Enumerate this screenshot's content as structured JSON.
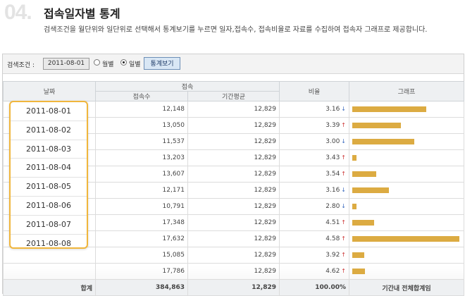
{
  "header": {
    "step": "04.",
    "title": "접속일자별 통계",
    "description": "검색조건을 월단위와 일단위로 선택해서 통계보기를 누르면 일자,접속수, 접속비율로 자료를 수집하여 접속자 그래프로 제공합니다."
  },
  "search": {
    "label": "검색조건 :",
    "date": "2011-08-01",
    "radio_month": "월별",
    "radio_day": "일별",
    "selected": "day",
    "button": "통계보기"
  },
  "table": {
    "headers": {
      "date": "날짜",
      "access": "접속",
      "access_count": "접속수",
      "period_avg": "기간평균",
      "ratio": "비율",
      "graph": "그래프"
    },
    "rows": [
      {
        "count": "12,148",
        "avg": "12,829",
        "ratio": "3.16",
        "trend": "down",
        "ratio_value": 3.16
      },
      {
        "count": "13,050",
        "avg": "12,829",
        "ratio": "3.39",
        "trend": "up",
        "ratio_value": 3.39
      },
      {
        "count": "11,537",
        "avg": "12,829",
        "ratio": "3.00",
        "trend": "down",
        "ratio_value": 3.0
      },
      {
        "count": "13,203",
        "avg": "12,829",
        "ratio": "3.43",
        "trend": "up",
        "ratio_value": 3.43
      },
      {
        "count": "13,607",
        "avg": "12,829",
        "ratio": "3.54",
        "trend": "up",
        "ratio_value": 3.54
      },
      {
        "count": "12,171",
        "avg": "12,829",
        "ratio": "3.16",
        "trend": "down",
        "ratio_value": 3.16
      },
      {
        "count": "10,791",
        "avg": "12,829",
        "ratio": "2.80",
        "trend": "down",
        "ratio_value": 2.8
      },
      {
        "count": "17,348",
        "avg": "12,829",
        "ratio": "4.51",
        "trend": "up",
        "ratio_value": 4.51
      },
      {
        "count": "17,632",
        "avg": "12,829",
        "ratio": "4.58",
        "trend": "up",
        "ratio_value": 4.58
      },
      {
        "count": "15,085",
        "avg": "12,829",
        "ratio": "3.92",
        "trend": "up",
        "ratio_value": 3.92
      },
      {
        "count": "17,786",
        "avg": "12,829",
        "ratio": "4.62",
        "trend": "up",
        "ratio_value": 4.62
      }
    ],
    "graph_bar_levels": [
      0.68,
      0.45,
      0.57,
      0.04,
      0.22,
      0.34,
      0.04,
      0.2,
      0.99,
      0.11,
      0.12
    ],
    "total": {
      "label": "합계",
      "count": "384,863",
      "avg": "12,829",
      "ratio": "100.00%",
      "graph_note": "기간내 전체합계임"
    }
  },
  "date_popup": {
    "dates": [
      "2011-08-01",
      "2011-08-02",
      "2011-08-03",
      "2011-08-04",
      "2011-08-05",
      "2011-08-06",
      "2011-08-07",
      "2011-08-08"
    ]
  },
  "colors": {
    "bar": "#dcab42",
    "popup_border": "#f0b63c",
    "arrow_up": "#cc3333",
    "arrow_down": "#3b6bbf"
  }
}
